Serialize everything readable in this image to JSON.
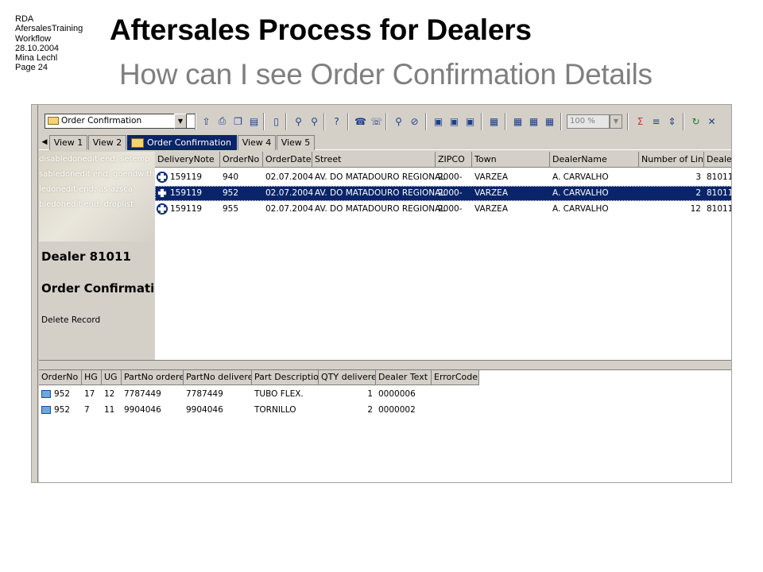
{
  "slide": {
    "meta": [
      "RDA",
      "AfersalesTraining",
      "Workflow",
      "28.10.2004",
      "Mina Lechl",
      "Page 24"
    ],
    "title": "Aftersales Process for Dealers",
    "subtitle": "How can I see Order Confirmation Details"
  },
  "toolbar": {
    "selector_value": "Order Confirmation",
    "zoom_value": "100 %"
  },
  "tabs": [
    "View 1",
    "View 2",
    "Order Confirmation",
    "View 4",
    "View 5"
  ],
  "active_tab": "Order Confirmation",
  "form": {
    "ghost_lines": [
      "disabledonedit end, setemp",
      "sabledonedit end, goendwith",
      "ledonedit end, as azsca",
      "bledonedit end, droplist"
    ],
    "dealer_title": "Dealer 81011",
    "section_title": "Order Confirmation",
    "delete_label": "Delete Record"
  },
  "upper_grid": {
    "columns": [
      "DeliveryNote",
      "OrderNo",
      "OrderDate",
      "Street",
      "ZIPCO",
      "Town",
      "DealerName",
      "Number of Lines",
      "DealerNo"
    ],
    "rows": [
      [
        "159119",
        "940",
        "02.07.2004",
        "AV. DO MATADOURO REGIONAL",
        "2000-",
        "VARZEA",
        "A. CARVALHO",
        "3",
        "81011"
      ],
      [
        "159119",
        "952",
        "02.07.2004",
        "AV. DO MATADOURO REGIONAL",
        "2000-",
        "VARZEA",
        "A. CARVALHO",
        "2",
        "81011"
      ],
      [
        "159119",
        "955",
        "02.07.2004",
        "AV. DO MATADOURO REGIONAL",
        "2000-",
        "VARZEA",
        "A. CARVALHO",
        "12",
        "81011"
      ]
    ],
    "selected_row": 1
  },
  "lower_grid": {
    "columns": [
      "OrderNo",
      "HG",
      "UG",
      "PartNo ordered",
      "PartNo delivered",
      "Part Description",
      "QTY delivered",
      "Dealer Text",
      "ErrorCode"
    ],
    "rows": [
      [
        "952",
        "17",
        "12",
        "7787449",
        "7787449",
        "TUBO FLEX.",
        "1",
        "0000006",
        ""
      ],
      [
        "952",
        "7",
        "11",
        "9904046",
        "9904046",
        "TORNILLO",
        "2",
        "0000002",
        ""
      ]
    ]
  }
}
